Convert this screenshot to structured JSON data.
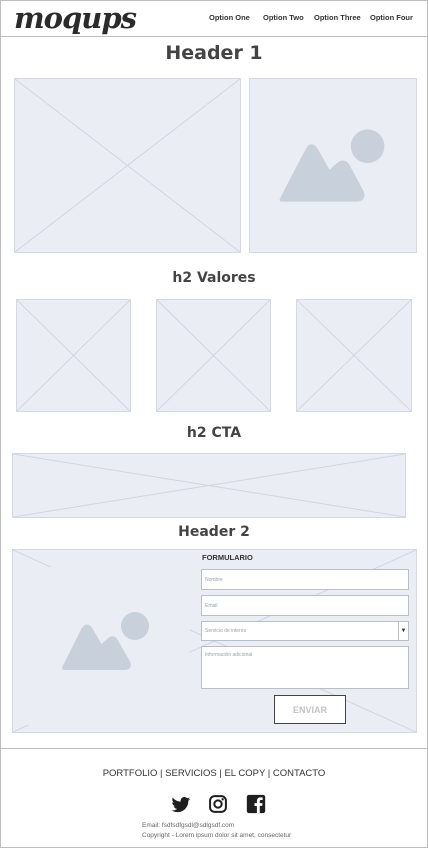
{
  "brand": {
    "logo": "moqups"
  },
  "nav": {
    "items": [
      {
        "label": "Option One"
      },
      {
        "label": "Option Two"
      },
      {
        "label": "Option Three"
      },
      {
        "label": "Option Four"
      }
    ]
  },
  "hero": {
    "heading": "Header 1"
  },
  "valores": {
    "heading": "h2 Valores"
  },
  "cta": {
    "heading": "h2 CTA"
  },
  "contact": {
    "heading": "Header 2",
    "form": {
      "title": "FORMULARIO",
      "name_placeholder": "Nombre",
      "email_placeholder": "Email",
      "service_placeholder": "Servicio de interés",
      "info_placeholder": "Información adicional",
      "submit_label": "ENVIAR"
    }
  },
  "footer": {
    "links": "PORTFOLIO | SERVICIOS | EL COPY | CONTACTO",
    "social": [
      "twitter-icon",
      "instagram-icon",
      "facebook-icon"
    ],
    "email": "Email: fsdfsdfgsdl@sdlgsdf.com",
    "copyright": "Copyright - Lorem ipsum dolor sit amet, consectetur"
  },
  "colors": {
    "placeholder_fill": "#eaedf3",
    "placeholder_line": "#d3d9e3",
    "image_glyph": "#c8d0db"
  }
}
